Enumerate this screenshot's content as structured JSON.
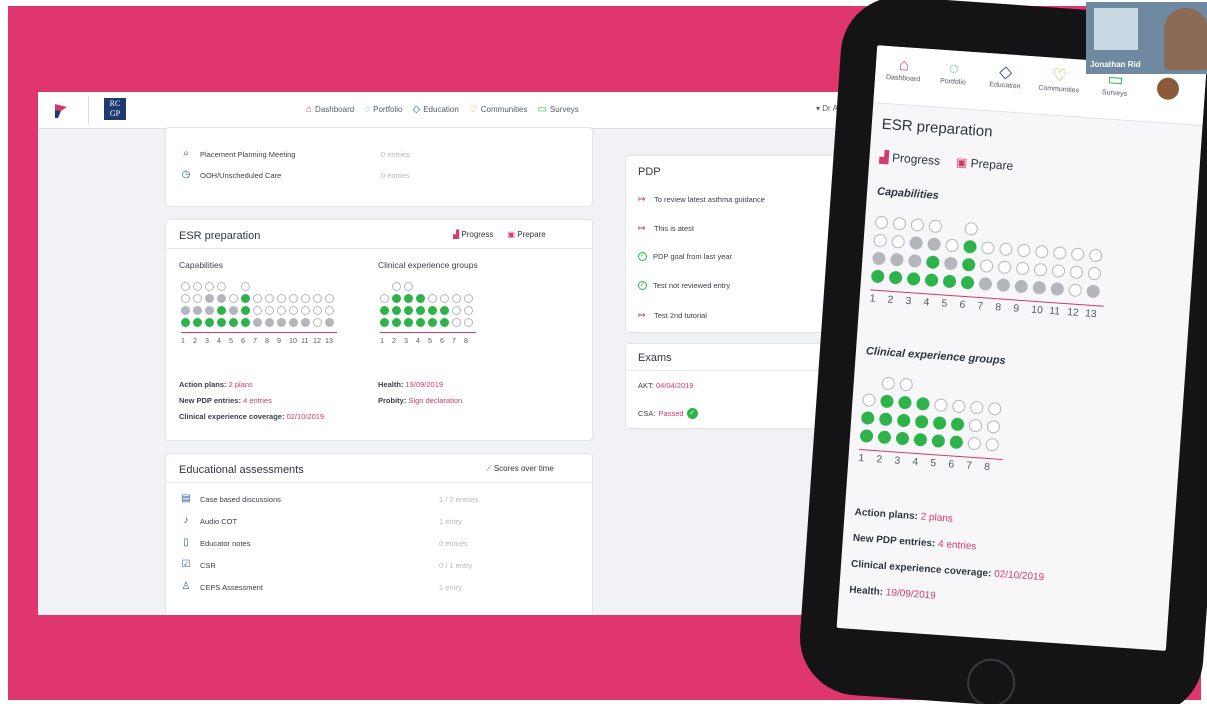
{
  "nav": {
    "items": [
      {
        "icon": "home-icon",
        "label": "Dashboard"
      },
      {
        "icon": "portfolio-icon",
        "label": "Portfolio"
      },
      {
        "icon": "education-icon",
        "label": "Education"
      },
      {
        "icon": "heart-icon",
        "label": "Communities"
      },
      {
        "icon": "chat-icon",
        "label": "Surveys"
      }
    ],
    "user": "▾ Dr Amy F",
    "logo_text": "RC GP"
  },
  "top_card": {
    "rows": [
      {
        "icon": "chat-icon",
        "label": "Placement Planning Meeting",
        "value": "0 entries"
      },
      {
        "icon": "clock-icon",
        "label": "OOH/Unscheduled Care",
        "value": "0 entries"
      }
    ]
  },
  "esr": {
    "title": "ESR preparation",
    "progress_label": "Progress",
    "prepare_label": "Prepare",
    "capabilities_title": "Capabilities",
    "clinical_title": "Clinical experience groups",
    "cap_axis": [
      "1",
      "2",
      "3",
      "4",
      "5",
      "6",
      "7",
      "8",
      "9",
      "10",
      "11",
      "12",
      "13"
    ],
    "cap_data": [
      [
        "g",
        "s",
        "o",
        "o"
      ],
      [
        "g",
        "s",
        "o",
        "o"
      ],
      [
        "g",
        "s",
        "s",
        "o"
      ],
      [
        "g",
        "g",
        "s",
        "o"
      ],
      [
        "g",
        "s",
        "o"
      ],
      [
        "g",
        "g",
        "g",
        "o"
      ],
      [
        "s",
        "o",
        "o"
      ],
      [
        "s",
        "o",
        "o"
      ],
      [
        "s",
        "o",
        "o"
      ],
      [
        "s",
        "o",
        "o"
      ],
      [
        "s",
        "o",
        "o"
      ],
      [
        "o",
        "o",
        "o"
      ],
      [
        "s",
        "o",
        "o"
      ]
    ],
    "ceg_axis": [
      "1",
      "2",
      "3",
      "4",
      "5",
      "6",
      "7",
      "8"
    ],
    "ceg_data": [
      [
        "g",
        "g",
        "o"
      ],
      [
        "g",
        "g",
        "g",
        "o"
      ],
      [
        "g",
        "g",
        "g",
        "o"
      ],
      [
        "g",
        "g",
        "g"
      ],
      [
        "g",
        "g",
        "o"
      ],
      [
        "g",
        "g",
        "o"
      ],
      [
        "o",
        "o",
        "o"
      ],
      [
        "o",
        "o",
        "o"
      ]
    ],
    "action_plans_label": "Action plans:",
    "action_plans_value": "2 plans",
    "pdp_label": "New PDP entries:",
    "pdp_value": "4 entries",
    "coverage_label": "Clinical experience coverage:",
    "coverage_value": "02/10/2019",
    "health_label": "Health:",
    "health_value": "19/09/2019",
    "probity_label": "Probity:",
    "probity_value": "Sign declaration"
  },
  "edu": {
    "title": "Educational assessments",
    "scores_label": "Scores over time",
    "rows": [
      {
        "icon": "briefcase-icon",
        "label": "Case based discussions",
        "value": "1 / 2 entries"
      },
      {
        "icon": "microphone-icon",
        "label": "Audio COT",
        "value": "1 entry"
      },
      {
        "icon": "document-icon",
        "label": "Educator notes",
        "value": "0 entries"
      },
      {
        "icon": "checkbox-icon",
        "label": "CSR",
        "value": "0 / 1 entry"
      },
      {
        "icon": "person-icon",
        "label": "CEPS Assessment",
        "value": "1 entry"
      }
    ]
  },
  "pdp": {
    "title": "PDP",
    "items": [
      {
        "type": "arrow",
        "label": "To review latest asthma guidance"
      },
      {
        "type": "arrow",
        "label": "This is atest"
      },
      {
        "type": "check",
        "label": "PDP goal from last year"
      },
      {
        "type": "check",
        "label": "Test not reviewed entry"
      },
      {
        "type": "arrow",
        "label": "Test 2nd tutorial"
      }
    ]
  },
  "exams": {
    "title": "Exams",
    "akt_label": "AKT:",
    "akt_value": "04/04/2019",
    "csa_label": "CSA:",
    "csa_value": "Passed"
  },
  "phone": {
    "nav": [
      "Dashboard",
      "Portfolio",
      "Education",
      "Communities",
      "Surveys"
    ],
    "title": "ESR preparation",
    "progress_label": "Progress",
    "prepare_label": "Prepare",
    "capabilities_title": "Capabilities",
    "clinical_title": "Clinical experience groups",
    "action_plans_label": "Action plans:",
    "action_plans_value": "2 plans",
    "pdp_label": "New PDP entries:",
    "pdp_value": "4 entries",
    "coverage_label": "Clinical experience coverage:",
    "coverage_value": "02/10/2019",
    "health_label": "Health:",
    "health_value": "19/09/2019"
  },
  "video": {
    "participant": "Jonathan Rid"
  },
  "colors": {
    "background": "#e0366e",
    "accent": "#d13a6a",
    "complete": "#2db34a",
    "partial": "#b3b6bc"
  }
}
